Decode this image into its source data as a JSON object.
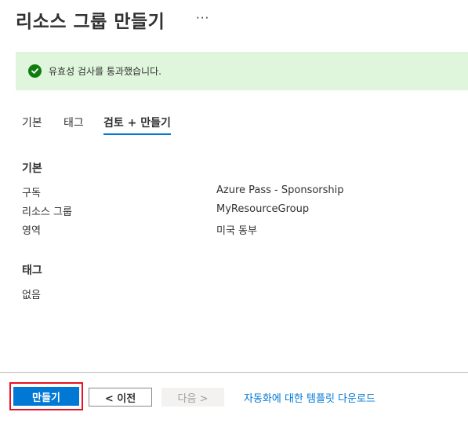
{
  "header": {
    "title": "리소스 그룹 만들기",
    "more_label": "···"
  },
  "banner": {
    "icon": "check-circle-icon",
    "text": "유효성 검사를 통과했습니다.",
    "color": "#dff6dd",
    "icon_color": "#107c10"
  },
  "tabs": [
    {
      "label": "기본",
      "active": false
    },
    {
      "label": "태그",
      "active": false
    },
    {
      "label": "검토 + 만들기",
      "active": true
    }
  ],
  "basics": {
    "title": "기본",
    "rows": [
      {
        "label": "구독",
        "value": "Azure Pass - Sponsorship"
      },
      {
        "label": "리소스 그룹",
        "value": "MyResourceGroup"
      },
      {
        "label": "영역",
        "value": "미국 동부"
      }
    ]
  },
  "tags_section": {
    "title": "태그",
    "empty_text": "없음"
  },
  "footer": {
    "create_label": "만들기",
    "prev_label": "< 이전",
    "next_label": "다음 >",
    "template_link": "자동화에 대한 템플릿 다운로드"
  },
  "colors": {
    "accent": "#0078d4",
    "highlight": "#e81123"
  }
}
